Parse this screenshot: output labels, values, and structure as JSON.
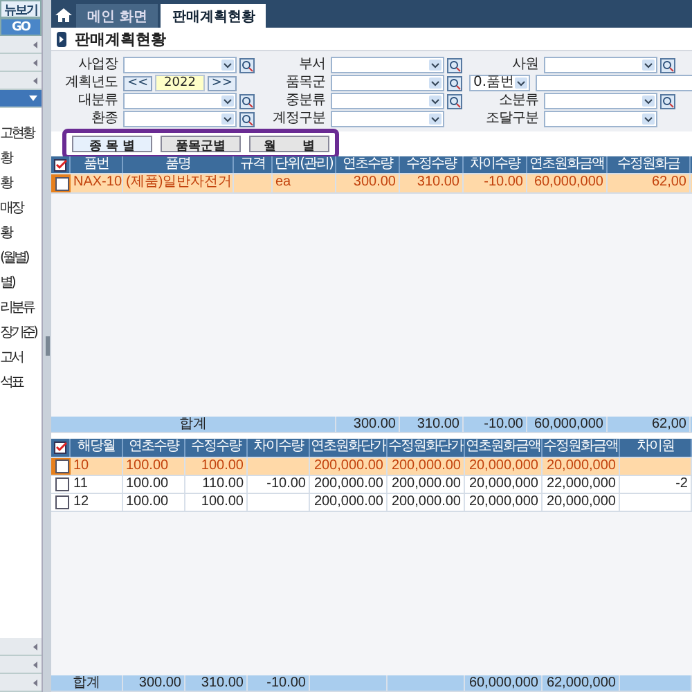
{
  "sidebar": {
    "view_button": "뉴보기",
    "go_button": "GO",
    "top_bars": [
      {
        "expanded": false
      },
      {
        "expanded": false
      },
      {
        "expanded": false
      },
      {
        "expanded": true
      }
    ],
    "tree_items": [
      "고현황",
      "황",
      "황",
      "매장",
      "황",
      "(월별)",
      "별)",
      "리분류",
      "장기준)",
      "고서",
      "석표"
    ],
    "bottom_bars": [
      {
        "expanded": false
      },
      {
        "expanded": false
      },
      {
        "expanded": false
      }
    ]
  },
  "tabs": [
    {
      "label": "메인 화면",
      "selected": false
    },
    {
      "label": "판매계획현황",
      "selected": true
    }
  ],
  "page_title": "판매계획현황",
  "filters": [
    [
      {
        "kind": "select",
        "label": "사업장",
        "lookup": true
      },
      {
        "kind": "select",
        "label": "부서",
        "lookup": true
      },
      {
        "kind": "select",
        "label": "사원",
        "lookup": true
      }
    ],
    [
      {
        "kind": "year",
        "label": "계획년도",
        "prev": "<<",
        "value": "2022",
        "next": ">>"
      },
      {
        "kind": "select",
        "label": "품목군",
        "lookup": true
      },
      {
        "kind": "code",
        "value": "0.품번"
      }
    ],
    [
      {
        "kind": "select",
        "label": "대분류",
        "lookup": true
      },
      {
        "kind": "select",
        "label": "중분류",
        "lookup": true
      },
      {
        "kind": "select",
        "label": "소분류",
        "lookup": true
      }
    ],
    [
      {
        "kind": "select",
        "label": "환종",
        "lookup": true
      },
      {
        "kind": "select",
        "label": "계정구분",
        "lookup": false
      },
      {
        "kind": "select",
        "label": "조달구분",
        "lookup": false
      }
    ]
  ],
  "view_tabs": [
    {
      "label": "종 목 별",
      "selected": true
    },
    {
      "label": "품목군별",
      "selected": false
    },
    {
      "label": "월      별",
      "selected": false
    }
  ],
  "grid1": {
    "columns": [
      "품번",
      "품명",
      "규격",
      "단위(관리)",
      "연초수량",
      "수정수량",
      "차이수량",
      "연초원화금액",
      "수정원화금"
    ],
    "rows": [
      {
        "selected": true,
        "checked": false,
        "cells": [
          "NAX-10",
          "(제품)일반자전거",
          null,
          "ea",
          "300.00",
          "310.00",
          "-10.00",
          "60,000,000",
          "62,00"
        ]
      }
    ],
    "totals": {
      "label": "합계",
      "values": [
        {
          "kind": "value",
          "value": "300.00"
        },
        {
          "kind": "value",
          "value": "310.00"
        },
        {
          "kind": "value",
          "value": "-10.00"
        },
        {
          "kind": "value",
          "value": "60,000,000"
        },
        {
          "kind": "value",
          "value": "62,00"
        }
      ]
    }
  },
  "grid2": {
    "columns": [
      "해당월",
      "연초수량",
      "수정수량",
      "차이수량",
      "연초원화단가",
      "수정원화단가",
      "연초원화금액",
      "수정원화금액",
      "차이원"
    ],
    "rows": [
      {
        "selected": true,
        "checked": false,
        "cells": [
          "10",
          "100.00",
          "100.00",
          null,
          "200,000.00",
          "200,000.00",
          "20,000,000",
          "20,000,000",
          null
        ]
      },
      {
        "selected": false,
        "checked": false,
        "cells": [
          "11",
          "100.00",
          "110.00",
          "-10.00",
          "200,000.00",
          "200,000.00",
          "20,000,000",
          "22,000,000",
          "-2"
        ]
      },
      {
        "selected": false,
        "checked": false,
        "cells": [
          "12",
          "100.00",
          "100.00",
          null,
          "200,000.00",
          "200,000.00",
          "20,000,000",
          "20,000,000",
          null
        ]
      }
    ],
    "totals": {
      "label": "합계",
      "values": [
        {
          "kind": "value",
          "value": "300.00"
        },
        {
          "kind": "value",
          "value": "310.00"
        },
        {
          "kind": "value",
          "value": "-10.00"
        },
        {
          "kind": "blank"
        },
        {
          "kind": "blank"
        },
        {
          "kind": "value",
          "value": "60,000,000"
        },
        {
          "kind": "value",
          "value": "62,000,000"
        },
        {
          "kind": "blank"
        }
      ]
    }
  }
}
